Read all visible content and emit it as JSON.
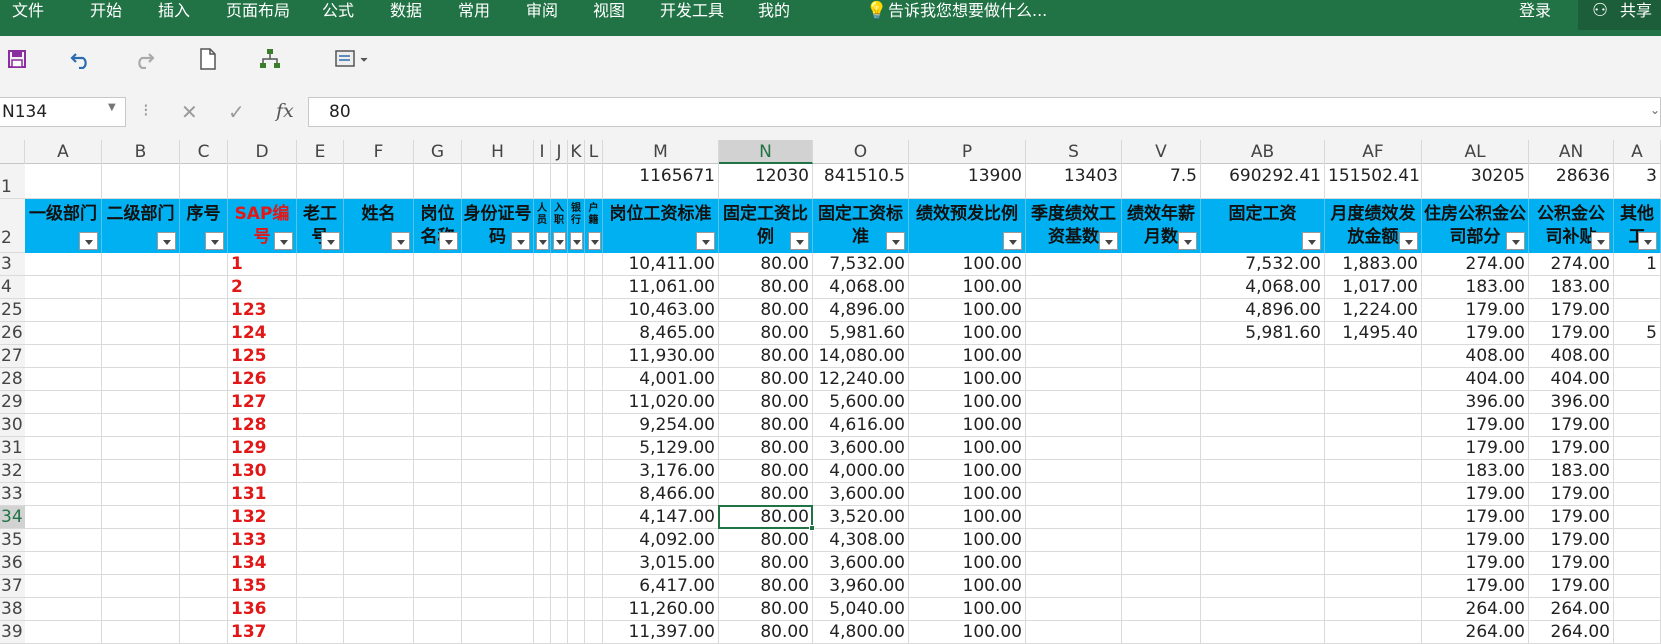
{
  "menu": {
    "items": [
      "文件",
      "开始",
      "插入",
      "页面布局",
      "公式",
      "数据",
      "常用",
      "审阅",
      "视图",
      "开发工具",
      "我的"
    ],
    "tell_me": "告诉我您想要做什么...",
    "login": "登录",
    "share": "共享"
  },
  "toolbar": {
    "icons": [
      "save-icon",
      "undo-icon",
      "redo-icon",
      "new-document-icon",
      "org-chart-icon",
      "form-icon"
    ]
  },
  "formula_bar": {
    "name_box": "N134",
    "fx": "fx",
    "value": "80"
  },
  "columns": [
    "A",
    "B",
    "C",
    "D",
    "E",
    "F",
    "G",
    "H",
    "I",
    "J",
    "K",
    "L",
    "M",
    "N",
    "O",
    "P",
    "S",
    "V",
    "AB",
    "AF",
    "AL",
    "AN",
    "A"
  ],
  "selected_column": "N",
  "row1": {
    "label": "1",
    "M": "1165671",
    "N": "12030",
    "O": "841510.5",
    "P": "13900",
    "S": "13403",
    "V": "7.5",
    "AB": "690292.41",
    "AF": "151502.41",
    "AL": "30205",
    "AN": "28636",
    "AR": "3"
  },
  "headers": {
    "label": "2",
    "A": "一级部门",
    "B": "二级部门",
    "C": "序号",
    "D": "SAP编号",
    "E": "老工号",
    "F": "姓名",
    "G": "岗位名称",
    "H": "身份证号码",
    "I": "人员",
    "J": "入职",
    "K": "银行",
    "L": "户籍",
    "M": "岗位工资标准",
    "N": "固定工资比例",
    "O": "固定工资标准",
    "P": "绩效预发比例",
    "S": "季度绩效工资基数",
    "V": "绩效年薪月数",
    "AB": "固定工资",
    "AF": "月度绩效发放金额",
    "AL": "住房公积金公司部分",
    "AN": "公积金公司补贴",
    "AR": "其他工"
  },
  "rows": [
    {
      "row": "3",
      "D": "1",
      "M": "10,411.00",
      "N": "80.00",
      "O": "7,532.00",
      "P": "100.00",
      "AB": "7,532.00",
      "AF": "1,883.00",
      "AL": "274.00",
      "AN": "274.00",
      "AR": "1"
    },
    {
      "row": "4",
      "D": "2",
      "M": "11,061.00",
      "N": "80.00",
      "O": "4,068.00",
      "P": "100.00",
      "AB": "4,068.00",
      "AF": "1,017.00",
      "AL": "183.00",
      "AN": "183.00",
      "AR": ""
    },
    {
      "row": "25",
      "D": "123",
      "M": "10,463.00",
      "N": "80.00",
      "O": "4,896.00",
      "P": "100.00",
      "AB": "4,896.00",
      "AF": "1,224.00",
      "AL": "179.00",
      "AN": "179.00",
      "AR": ""
    },
    {
      "row": "26",
      "D": "124",
      "M": "8,465.00",
      "N": "80.00",
      "O": "5,981.60",
      "P": "100.00",
      "AB": "5,981.60",
      "AF": "1,495.40",
      "AL": "179.00",
      "AN": "179.00",
      "AR": "5"
    },
    {
      "row": "27",
      "D": "125",
      "M": "11,930.00",
      "N": "80.00",
      "O": "14,080.00",
      "P": "100.00",
      "AB": "",
      "AF": "",
      "AL": "408.00",
      "AN": "408.00",
      "AR": ""
    },
    {
      "row": "28",
      "D": "126",
      "M": "4,001.00",
      "N": "80.00",
      "O": "12,240.00",
      "P": "100.00",
      "AB": "",
      "AF": "",
      "AL": "404.00",
      "AN": "404.00",
      "AR": ""
    },
    {
      "row": "29",
      "D": "127",
      "M": "11,020.00",
      "N": "80.00",
      "O": "5,600.00",
      "P": "100.00",
      "AB": "",
      "AF": "",
      "AL": "396.00",
      "AN": "396.00",
      "AR": ""
    },
    {
      "row": "30",
      "D": "128",
      "M": "9,254.00",
      "N": "80.00",
      "O": "4,616.00",
      "P": "100.00",
      "AB": "",
      "AF": "",
      "AL": "179.00",
      "AN": "179.00",
      "AR": ""
    },
    {
      "row": "31",
      "D": "129",
      "M": "5,129.00",
      "N": "80.00",
      "O": "3,600.00",
      "P": "100.00",
      "AB": "",
      "AF": "",
      "AL": "179.00",
      "AN": "179.00",
      "AR": ""
    },
    {
      "row": "32",
      "D": "130",
      "M": "3,176.00",
      "N": "80.00",
      "O": "4,000.00",
      "P": "100.00",
      "AB": "",
      "AF": "",
      "AL": "183.00",
      "AN": "183.00",
      "AR": ""
    },
    {
      "row": "33",
      "D": "131",
      "M": "8,466.00",
      "N": "80.00",
      "O": "3,600.00",
      "P": "100.00",
      "AB": "",
      "AF": "",
      "AL": "179.00",
      "AN": "179.00",
      "AR": ""
    },
    {
      "row": "34",
      "D": "132",
      "M": "4,147.00",
      "N": "80.00",
      "O": "3,520.00",
      "P": "100.00",
      "AB": "",
      "AF": "",
      "AL": "179.00",
      "AN": "179.00",
      "AR": ""
    },
    {
      "row": "35",
      "D": "133",
      "M": "4,092.00",
      "N": "80.00",
      "O": "4,308.00",
      "P": "100.00",
      "AB": "",
      "AF": "",
      "AL": "179.00",
      "AN": "179.00",
      "AR": ""
    },
    {
      "row": "36",
      "D": "134",
      "M": "3,015.00",
      "N": "80.00",
      "O": "3,600.00",
      "P": "100.00",
      "AB": "",
      "AF": "",
      "AL": "179.00",
      "AN": "179.00",
      "AR": ""
    },
    {
      "row": "37",
      "D": "135",
      "M": "6,417.00",
      "N": "80.00",
      "O": "3,960.00",
      "P": "100.00",
      "AB": "",
      "AF": "",
      "AL": "179.00",
      "AN": "179.00",
      "AR": ""
    },
    {
      "row": "38",
      "D": "136",
      "M": "11,260.00",
      "N": "80.00",
      "O": "5,040.00",
      "P": "100.00",
      "AB": "",
      "AF": "",
      "AL": "264.00",
      "AN": "264.00",
      "AR": ""
    },
    {
      "row": "39",
      "D": "137",
      "M": "11,397.00",
      "N": "80.00",
      "O": "4,800.00",
      "P": "100.00",
      "AB": "",
      "AF": "",
      "AL": "264.00",
      "AN": "264.00",
      "AR": ""
    }
  ],
  "selected_row": "34",
  "colors": {
    "ribbon": "#217346",
    "header_fill": "#00b0f0",
    "sap_text": "#e21717",
    "selection": "#217346"
  }
}
